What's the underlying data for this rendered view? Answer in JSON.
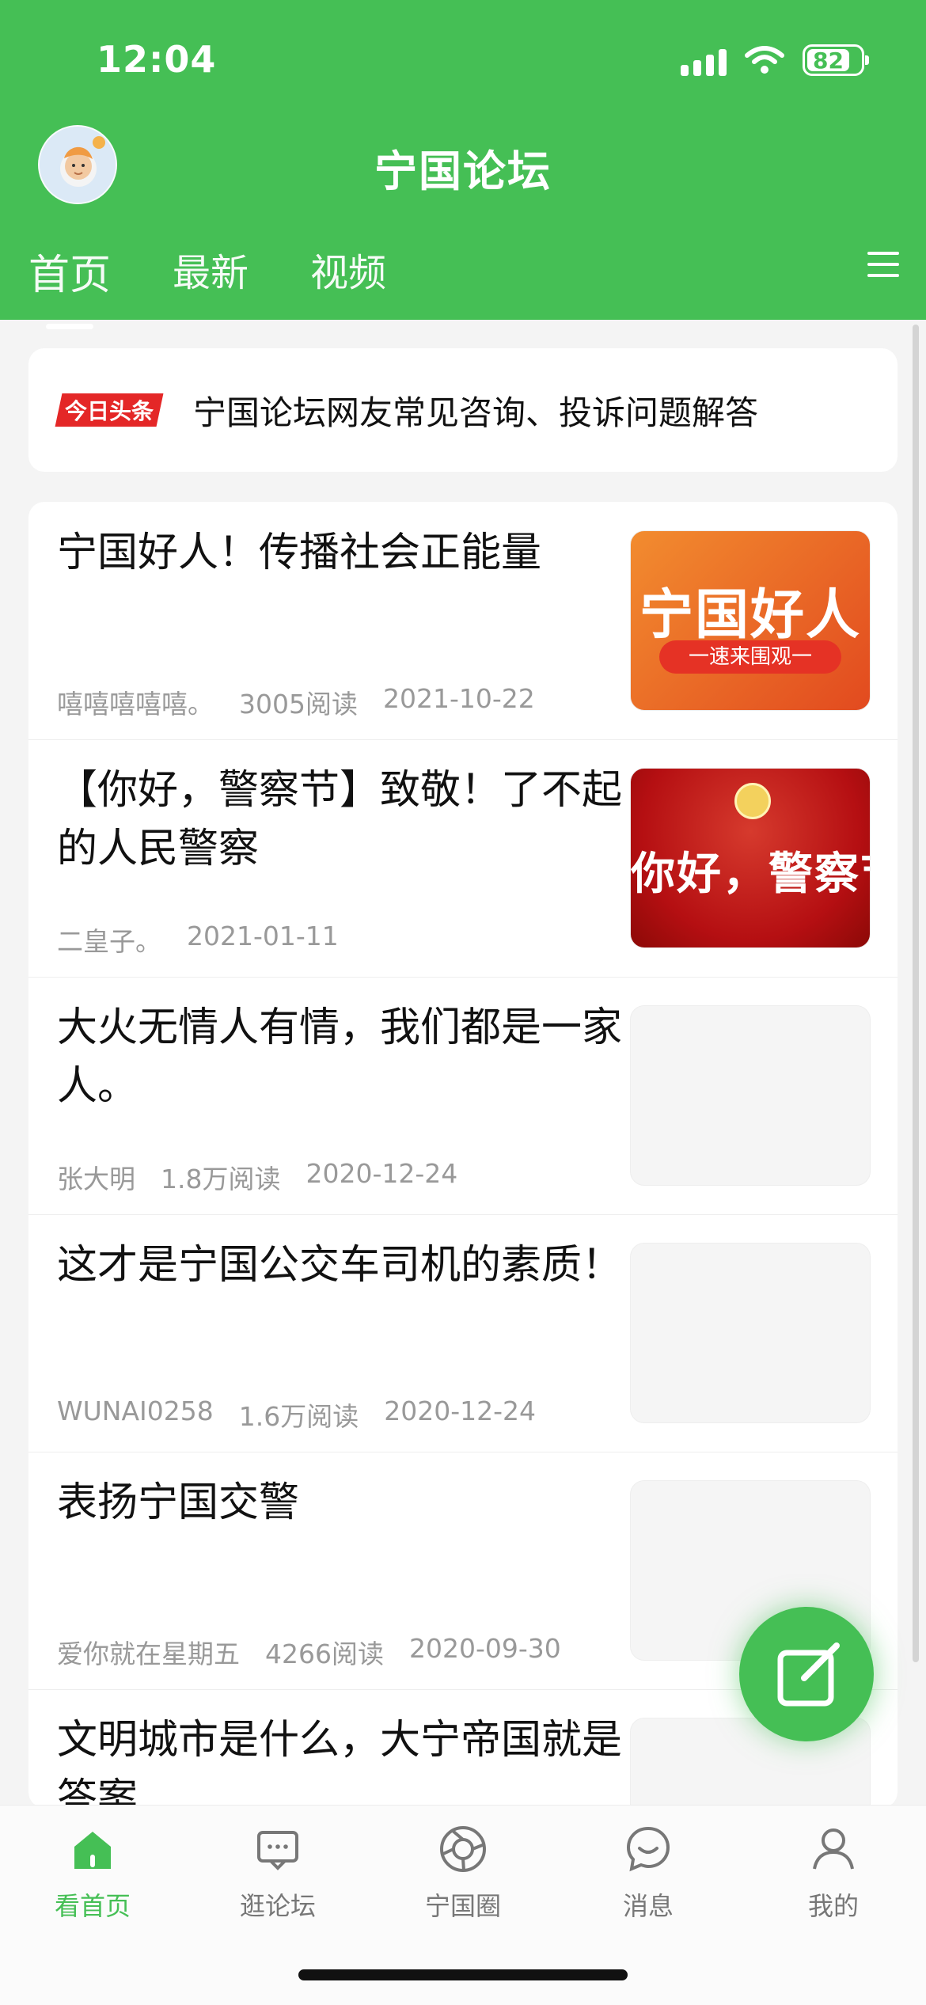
{
  "status_bar": {
    "time": "12:04",
    "battery": "82"
  },
  "header": {
    "title": "宁国论坛",
    "tabs": [
      {
        "label": "首页",
        "active": true
      },
      {
        "label": "最新"
      },
      {
        "label": "视频"
      }
    ],
    "avatar_icon": "cartoon-avatar",
    "menu_icon": "hamburger-menu-icon"
  },
  "notice": {
    "badge": "今日头条",
    "text": "宁国论坛网友常见咨询、投诉问题解答"
  },
  "posts": [
    {
      "title": "宁国好人！传播社会正能量",
      "author": "嘻嘻嘻嘻嘻。",
      "reads": "3005阅读",
      "date": "2021-10-22",
      "thumb": "orange",
      "thumb_text": "宁国好人",
      "thumb_sub": "一速来围观一"
    },
    {
      "title": "【你好，警察节】致敬！了不起的人民警察",
      "author": "二皇子。",
      "reads": "",
      "date": "2021-01-11",
      "thumb": "red",
      "thumb_text": "你好，警察节",
      "thumb_sub": ""
    },
    {
      "title": "大火无情人有情，我们都是一家人。",
      "author": "张大明",
      "reads": "1.8万阅读",
      "date": "2020-12-24",
      "thumb": "blank",
      "thumb_text": "",
      "thumb_sub": ""
    },
    {
      "title": "这才是宁国公交车司机的素质！",
      "author": "WUNAI0258",
      "reads": "1.6万阅读",
      "date": "2020-12-24",
      "thumb": "blank",
      "thumb_text": "",
      "thumb_sub": ""
    },
    {
      "title": "表扬宁国交警",
      "author": "爱你就在星期五",
      "reads": "4266阅读",
      "date": "2020-09-30",
      "thumb": "blank",
      "thumb_text": "",
      "thumb_sub": ""
    },
    {
      "title": "文明城市是什么，大宁帝国就是答案",
      "author": "",
      "reads": "",
      "date": "",
      "thumb": "blank",
      "thumb_text": "",
      "thumb_sub": ""
    }
  ],
  "fab": {
    "icon": "edit-icon"
  },
  "bottom_nav": [
    {
      "label": "看首页",
      "icon": "home-icon",
      "active": true
    },
    {
      "label": "逛论坛",
      "icon": "forum-chat-icon"
    },
    {
      "label": "宁国圈",
      "icon": "circle-aperture-icon"
    },
    {
      "label": "消息",
      "icon": "message-bubble-icon"
    },
    {
      "label": "我的",
      "icon": "profile-icon"
    }
  ],
  "colors": {
    "primary": "#45bf55",
    "badge_red": "#e42727"
  }
}
